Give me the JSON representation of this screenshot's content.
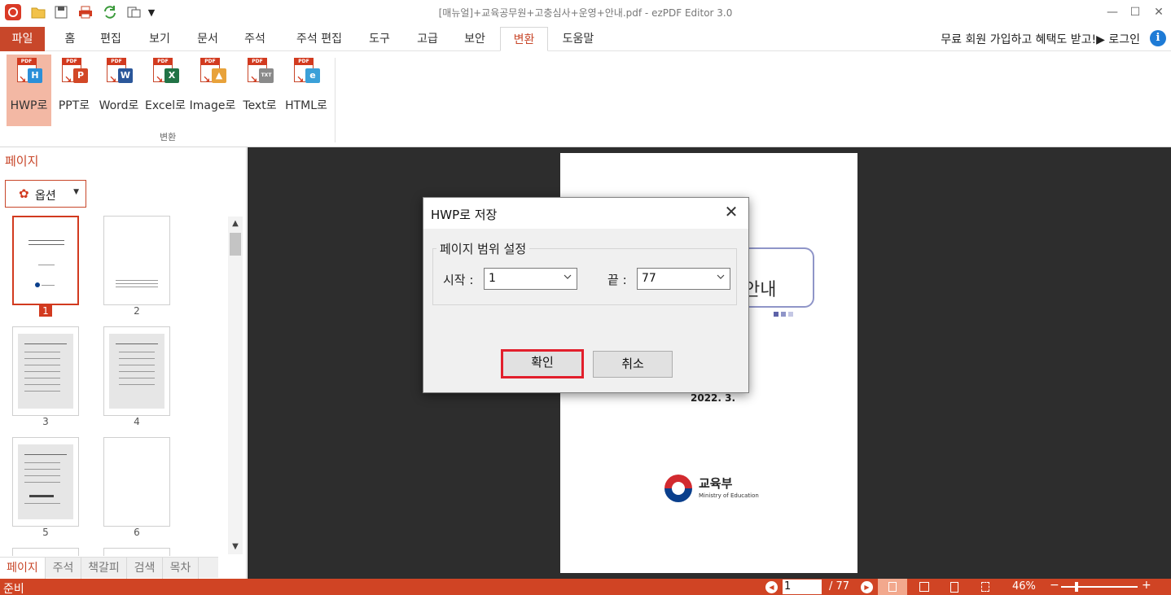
{
  "window": {
    "title": "[매뉴얼]+교육공무원+고충심사+운영+안내.pdf - ezPDF Editor 3.0",
    "minimize": "—",
    "maximize": "☐",
    "close": "✕"
  },
  "menu": {
    "file": "파일",
    "tabs": [
      "홈",
      "편집",
      "보기",
      "문서",
      "주석",
      "주석 편집",
      "도구",
      "고급",
      "보안",
      "변환",
      "도움말"
    ],
    "active_tab": "변환",
    "signup": "무료 회원 가입하고 혜택도 받고!▶ 로그인",
    "info": "i"
  },
  "ribbon": {
    "buttons": [
      {
        "label": "HWP로",
        "badge": "H",
        "badge_color": "#2b8fd8"
      },
      {
        "label": "PPT로",
        "badge": "P",
        "badge_color": "#d24726"
      },
      {
        "label": "Word로",
        "badge": "W",
        "badge_color": "#2b579a"
      },
      {
        "label": "Excel로",
        "badge": "X",
        "badge_color": "#217346"
      },
      {
        "label": "Image로",
        "badge": "▲",
        "badge_color": "#e8a23a"
      },
      {
        "label": "Text로",
        "badge": "TXT",
        "badge_color": "#8a8a8a"
      },
      {
        "label": "HTML로",
        "badge": "e",
        "badge_color": "#3aa0d8"
      }
    ],
    "group_label": "변환"
  },
  "left_panel": {
    "title": "페이지",
    "options_label": "옵션",
    "thumbnails": [
      "1",
      "2",
      "3",
      "4",
      "5",
      "6"
    ],
    "selected_page": "1",
    "bottom_tabs": [
      "페이지",
      "주석",
      "책갈피",
      "검색",
      "목차"
    ]
  },
  "document": {
    "title_fragment": "안내",
    "date": "2022. 3.",
    "ministry_kor": "교육부",
    "ministry_eng": "Ministry of Education"
  },
  "dialog": {
    "title": "HWP로 저장",
    "group_label": "페이지 범위 설정",
    "start_label": "시작 :",
    "start_value": "1",
    "end_label": "끝 :",
    "end_value": "77",
    "ok_label": "확인",
    "cancel_label": "취소"
  },
  "status": {
    "text": "준비",
    "current_page": "1",
    "total_pages": "/ 77",
    "zoom": "46%"
  },
  "colors": {
    "accent": "#c8472a",
    "status_bar": "#d04424",
    "highlight_border": "#e21f2c"
  }
}
